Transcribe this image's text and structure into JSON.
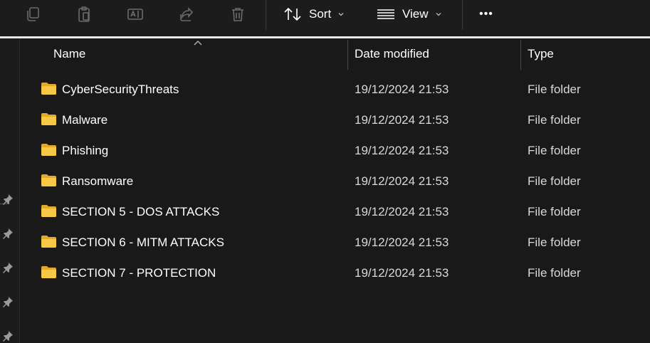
{
  "toolbar": {
    "icons": [
      "copy-icon",
      "paste-icon",
      "rename-icon",
      "share-icon",
      "delete-icon"
    ],
    "sort_label": "Sort",
    "view_label": "View",
    "more_label": "•••"
  },
  "columns": {
    "name": "Name",
    "date": "Date modified",
    "type": "Type"
  },
  "files": [
    {
      "name": "CyberSecurityThreats",
      "date": "19/12/2024 21:53",
      "type": "File folder"
    },
    {
      "name": "Malware",
      "date": "19/12/2024 21:53",
      "type": "File folder"
    },
    {
      "name": "Phishing",
      "date": "19/12/2024 21:53",
      "type": "File folder"
    },
    {
      "name": "Ransomware",
      "date": "19/12/2024 21:53",
      "type": "File folder"
    },
    {
      "name": "SECTION 5 - DOS ATTACKS",
      "date": "19/12/2024 21:53",
      "type": "File folder"
    },
    {
      "name": "SECTION 6 - MITM ATTACKS",
      "date": "19/12/2024 21:53",
      "type": "File folder"
    },
    {
      "name": "SECTION 7 - PROTECTION",
      "date": "19/12/2024 21:53",
      "type": "File folder"
    }
  ],
  "colors": {
    "folder": "#f7c746",
    "folder_dark": "#e3a92b",
    "icon_gray": "#6b6b6b"
  }
}
